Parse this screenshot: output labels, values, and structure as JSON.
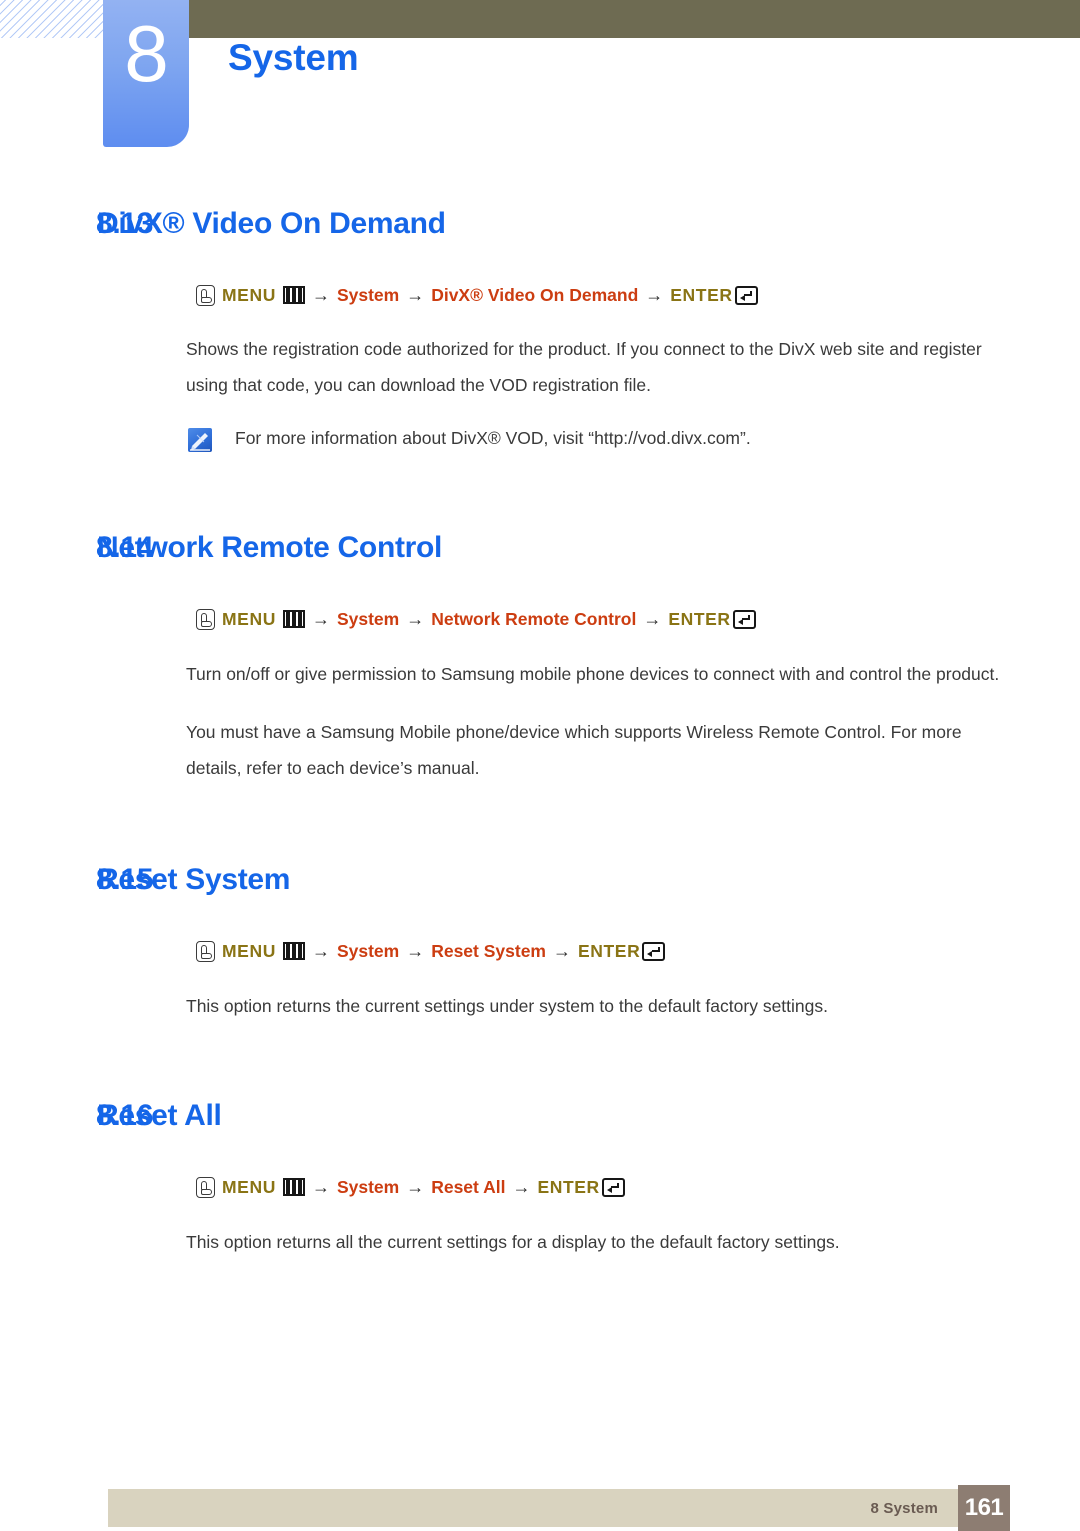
{
  "header": {
    "chapter_number": "8",
    "chapter_title": "System",
    "hatch_icon": "diagonal-hatch-pattern"
  },
  "colors": {
    "heading_blue": "#1566E8",
    "crumb_orange": "#CC3D11",
    "menu_olive": "#8A7415",
    "topbar_olive": "#6E6B52",
    "footer_beige": "#D9D3BF",
    "footer_page_taupe": "#8D7D72",
    "body_gray": "#3A3A3A"
  },
  "sections": [
    {
      "number": "8.13",
      "title": "DivX® Video On Demand",
      "path": {
        "menu": "MENU",
        "crumbs": [
          "System",
          "DivX® Video On Demand"
        ],
        "enter": "ENTER",
        "arrow": "→"
      },
      "paragraphs": [
        "Shows the registration code authorized for the product. If you connect to the DivX web site and register using that code, you can download the VOD registration file."
      ],
      "note": "For more information about DivX® VOD, visit “http://vod.divx.com”."
    },
    {
      "number": "8.14",
      "title": "Network Remote Control",
      "path": {
        "menu": "MENU",
        "crumbs": [
          "System",
          "Network Remote Control"
        ],
        "enter": "ENTER",
        "arrow": "→"
      },
      "paragraphs": [
        "Turn on/off or give permission to Samsung mobile phone devices to connect with and control the product.",
        "You must have a Samsung Mobile phone/device which supports Wireless Remote Control. For more details, refer to each device’s manual."
      ]
    },
    {
      "number": "8.15",
      "title": "Reset System",
      "path": {
        "menu": "MENU",
        "crumbs": [
          "System",
          "Reset System"
        ],
        "enter": "ENTER",
        "arrow": "→"
      },
      "paragraphs": [
        "This option returns the current settings under system to the default factory settings."
      ]
    },
    {
      "number": "8.16",
      "title": "Reset All",
      "path": {
        "menu": "MENU",
        "crumbs": [
          "System",
          "Reset All"
        ],
        "enter": "ENTER",
        "arrow": "→"
      },
      "paragraphs": [
        "This option returns all the current settings for a display to the default factory settings."
      ]
    }
  ],
  "footer": {
    "label": "8 System",
    "page_number": "161"
  }
}
